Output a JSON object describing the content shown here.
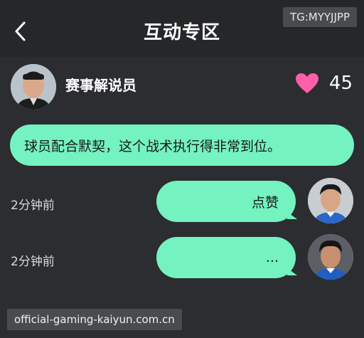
{
  "header": {
    "title": "互动专区",
    "back_icon": "chevron-left-icon",
    "watermark": "TG:MYYJJPP"
  },
  "post": {
    "author": "赛事解说员",
    "like_icon": "heart-icon",
    "like_color": "#ff5fa8",
    "like_count": "45",
    "message": "球员配合默契，这个战术执行得非常到位。"
  },
  "replies": [
    {
      "time": "2分钟前",
      "text": "点赞"
    },
    {
      "time": "2分钟前",
      "text": "..."
    }
  ],
  "footer": {
    "watermark": "official-gaming-kaiyun.com.cn"
  },
  "colors": {
    "background": "#2b2d30",
    "header_bg": "#262729",
    "bubble": "#74f2c0"
  }
}
